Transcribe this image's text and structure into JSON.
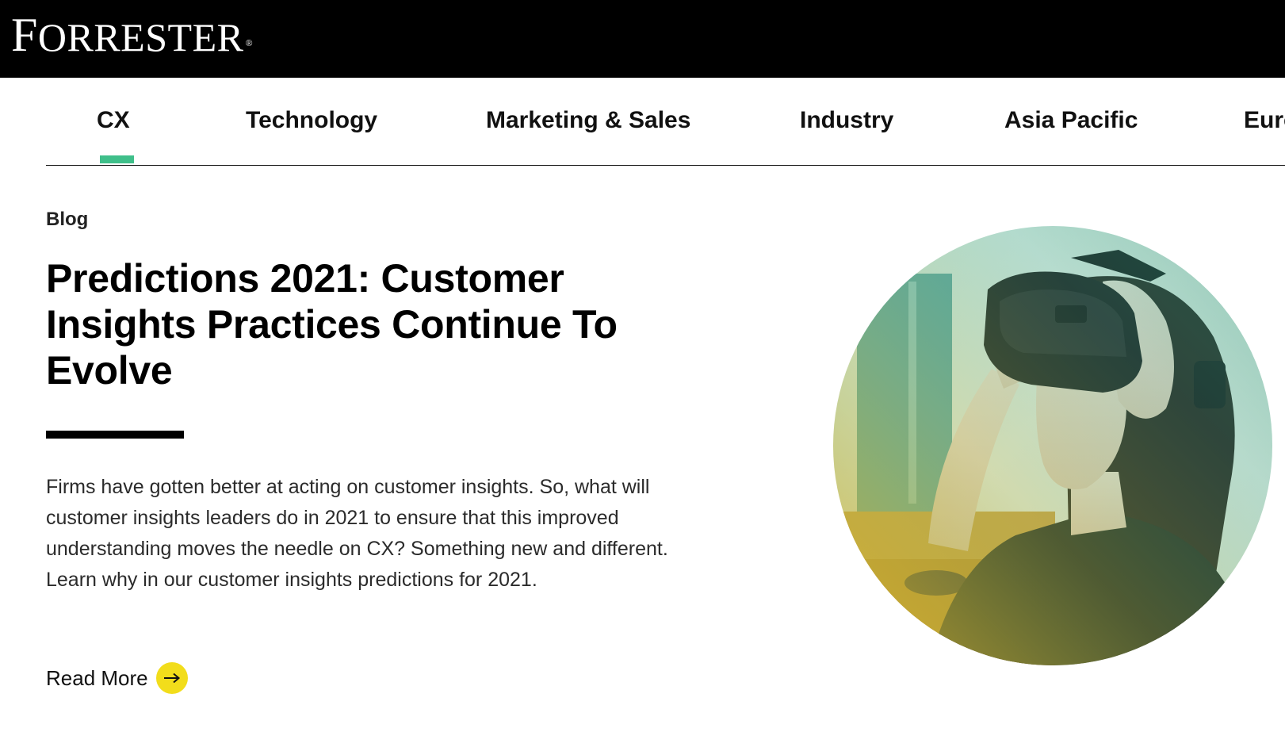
{
  "header": {
    "logo_first": "F",
    "logo_rest": "ORRESTER",
    "logo_mark": "®"
  },
  "nav": {
    "items": [
      {
        "label": "CX",
        "active": true
      },
      {
        "label": "Technology"
      },
      {
        "label": "Marketing & Sales"
      },
      {
        "label": "Industry"
      },
      {
        "label": "Asia Pacific"
      },
      {
        "label": "Europe"
      }
    ],
    "active_color": "#3fbf8a"
  },
  "article": {
    "eyebrow": "Blog",
    "title": "Predictions 2021: Customer Insights Practices Continue To Evolve",
    "description": "Firms have gotten better at acting on customer insights. So, what will customer insights leaders do in 2021 to ensure that this improved understanding moves the needle on CX? Something new and different. Learn why in our customer insights predictions for 2021.",
    "read_more": "Read More",
    "read_more_icon": "arrow-right-icon",
    "accent": "#f2dd1b"
  },
  "hero": {
    "image": "person-wearing-vr-headset"
  }
}
